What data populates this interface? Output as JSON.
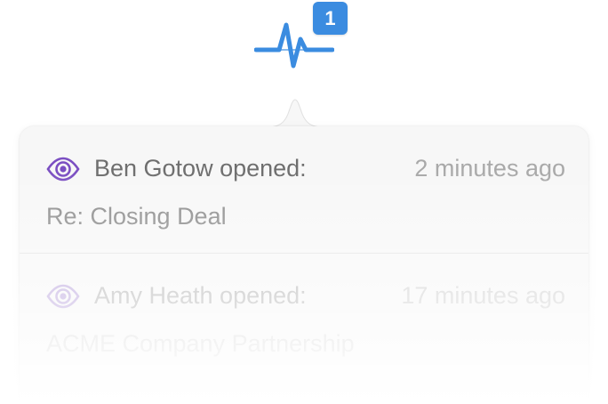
{
  "badge": {
    "count": "1"
  },
  "colors": {
    "accent": "#3b8ce0",
    "eye_purple": "#7b4fc2",
    "eye_faded": "#c9b8e6"
  },
  "icons": {
    "activity": "pulse-icon",
    "opened": "eye-icon"
  },
  "notifications": [
    {
      "who": "Ben Gotow opened:",
      "when": "2 minutes ago",
      "subject": "Re: Closing Deal"
    },
    {
      "who": "Amy Heath opened:",
      "when": "17 minutes ago",
      "subject": "ACME Company Partnership"
    }
  ]
}
